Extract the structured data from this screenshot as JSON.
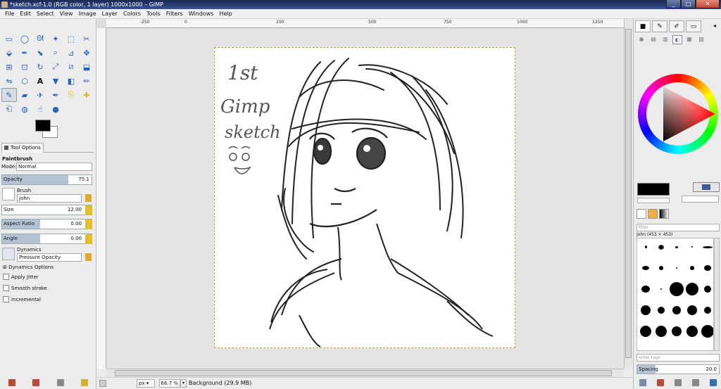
{
  "window": {
    "title": "*sketch.xcf-1.0 (RGB color, 1 layer) 1000x1000 – GIMP"
  },
  "menu": [
    "File",
    "Edit",
    "Select",
    "View",
    "Image",
    "Layer",
    "Colors",
    "Tools",
    "Filters",
    "Windows",
    "Help"
  ],
  "ruler": {
    "labels": [
      "-250",
      "0",
      "250",
      "500",
      "750",
      "1000",
      "1250"
    ]
  },
  "toolbox": {
    "tools": [
      "rect-select-icon",
      "ellipse-select-icon",
      "lasso-icon",
      "fuzzy-select-icon",
      "color-select-icon",
      "scissors-icon",
      "foreground-select-icon",
      "paths-icon",
      "color-picker-icon",
      "zoom-icon",
      "measure-icon",
      "move-icon",
      "align-icon",
      "crop-icon",
      "rotate-icon",
      "scale-icon",
      "shear-icon",
      "perspective-icon",
      "flip-icon",
      "cage-icon",
      "text-icon",
      "bucket-fill-icon",
      "blend-icon",
      "pencil-icon",
      "paintbrush-icon",
      "eraser-icon",
      "airbrush-icon",
      "ink-icon",
      "clone-icon",
      "heal-icon",
      "perspective-clone-icon",
      "blur-icon",
      "smudge-icon",
      "dodge-burn-icon"
    ]
  },
  "tool_options": {
    "tab_label": "Tool Options",
    "tool_name": "Paintbrush",
    "mode_label": "Mode:",
    "mode_value": "Normal",
    "opacity": {
      "label": "Opacity",
      "value": "75.1"
    },
    "brush_label": "Brush",
    "brush_value": "John",
    "size": {
      "label": "Size",
      "value": "12.00"
    },
    "aspect": {
      "label": "Aspect Ratio",
      "value": "0.00"
    },
    "angle": {
      "label": "Angle",
      "value": "0.00"
    },
    "dynamics_label": "Dynamics",
    "dynamics_value": "Pressure Opacity",
    "dynamics_options": "Dynamics Options",
    "apply_jitter": "Apply Jitter",
    "smooth_stroke": "Smooth stroke",
    "incremental": "Incremental"
  },
  "sketch_text": {
    "line1": "1st",
    "line2": "Gimp",
    "line3": "sketch"
  },
  "status": {
    "unit": "px",
    "zoom": "66.7 %",
    "layer": "Background (29.9 MB)"
  },
  "dock": {
    "filter_placeholder": "filter",
    "brush_info": "John (453 × 453)",
    "tags_placeholder": "enter tags",
    "spacing_label": "Spacing",
    "spacing_value": "20.0"
  },
  "colors": {
    "accent": "#b4c3d4",
    "fg": "#000000",
    "bg": "#ffffff",
    "title_bar": "#2a3f78"
  }
}
